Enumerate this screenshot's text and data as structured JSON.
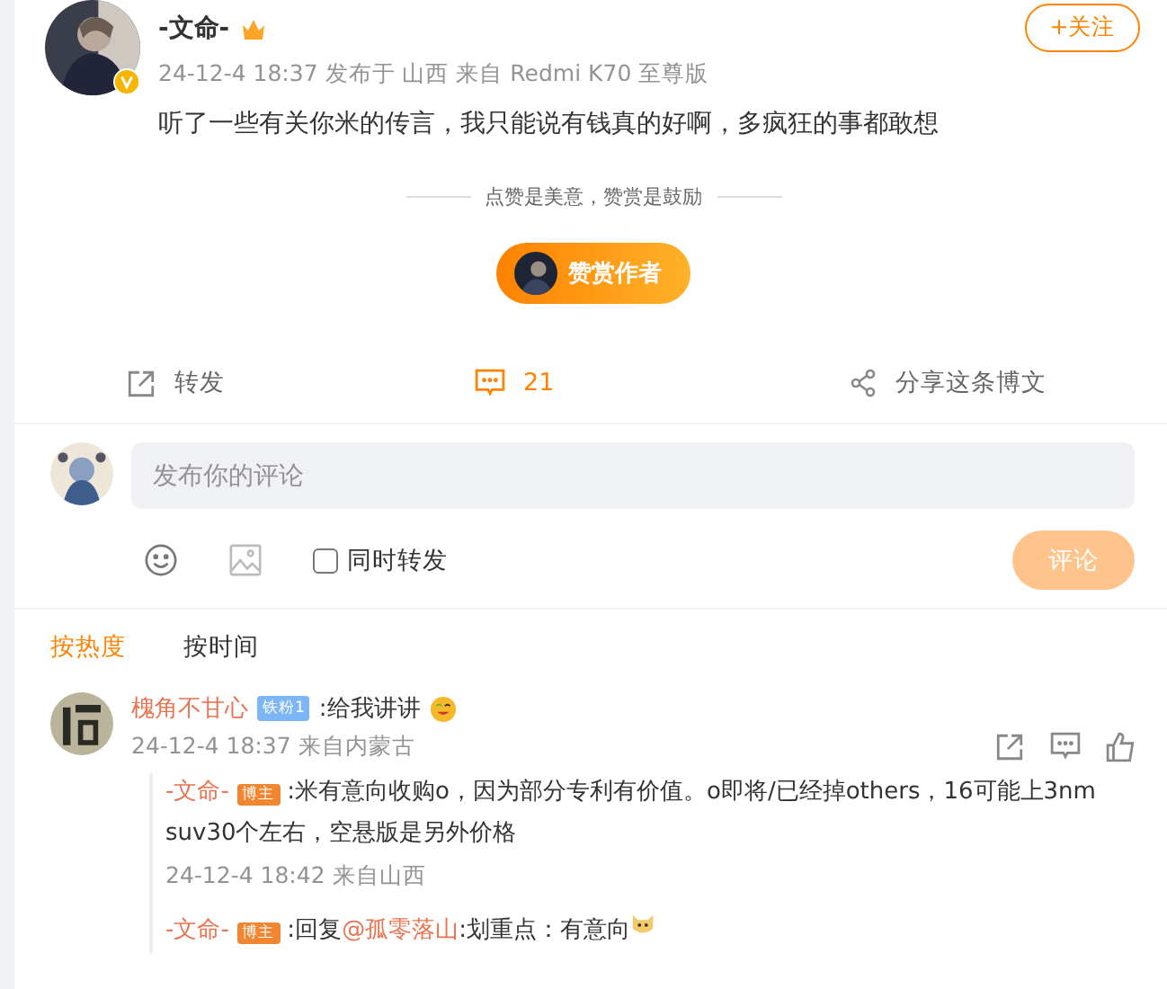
{
  "post": {
    "author": "-文命-",
    "meta": "24-12-4 18:37 发布于 山西 来自 Redmi K70 至尊版",
    "follow_button": "+关注",
    "text": "听了一些有关你米的传言，我只能说有钱真的好啊，多疯狂的事都敢想"
  },
  "reward": {
    "caption": "点赞是美意，赞赏是鼓励",
    "button": "赞赏作者"
  },
  "actions": [
    {
      "kind": "repost",
      "label": "转发",
      "selected": false
    },
    {
      "kind": "comment",
      "label": "21",
      "selected": true
    },
    {
      "kind": "share",
      "label": "分享这条博文",
      "selected": false
    }
  ],
  "composer": {
    "placeholder": "发布你的评论",
    "repost_label": "同时转发",
    "repost_checked": false,
    "submit": "评论",
    "submit_disabled": true
  },
  "sort_tabs": [
    {
      "label": "按热度",
      "selected": true
    },
    {
      "label": "按时间",
      "selected": false
    }
  ],
  "comments": [
    {
      "author": "槐角不甘心",
      "badge": "铁粉1",
      "text": ":给我讲讲",
      "meta": "24-12-4 18:37 来自内蒙古",
      "replies": [
        {
          "author": "-文命-",
          "badge": "博主",
          "text": ":米有意向收购o，因为部分专利有价值。o即将/已经掉others，16可能上3nm suv30个左右，空悬版是另外价格",
          "meta": "24-12-4 18:42 来自山西"
        },
        {
          "author": "-文命-",
          "badge": "博主",
          "prefix": ":回复",
          "mention": "@孤零落山",
          "text": ":划重点：有意向"
        }
      ]
    }
  ]
}
